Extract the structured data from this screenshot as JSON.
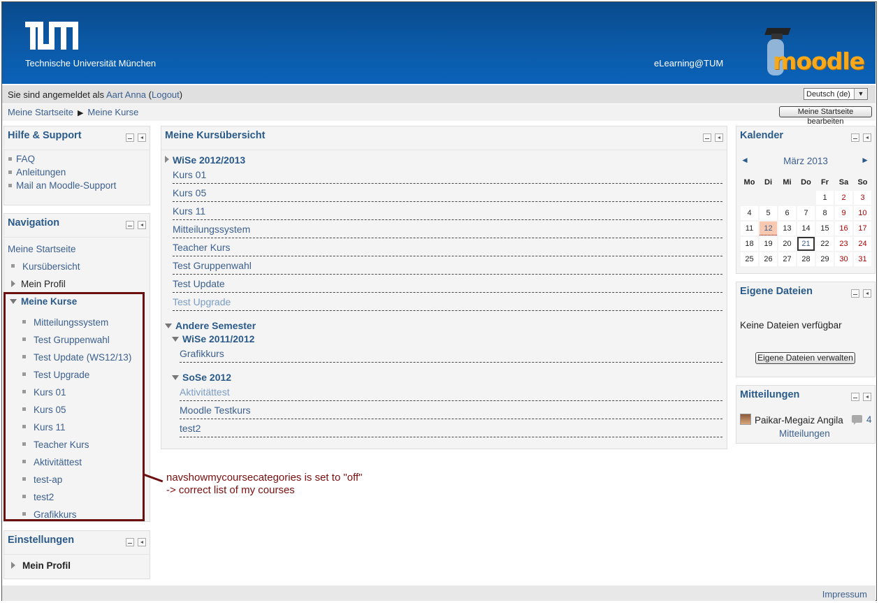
{
  "header": {
    "university": "Technische Universität München",
    "portal": "eLearning@TUM",
    "moodle_logo": "moodle"
  },
  "userbar": {
    "prefix": "Sie sind angemeldet als ",
    "username": "Aart Anna",
    "logout": "Logout",
    "language": "Deutsch (de)"
  },
  "breadcrumb": {
    "home": "Meine Startseite",
    "current": "Meine Kurse",
    "edit_button": "Meine Startseite bearbeiten"
  },
  "help_block": {
    "title": "Hilfe & Support",
    "items": [
      "FAQ",
      "Anleitungen",
      "Mail an Moodle-Support"
    ]
  },
  "navigation": {
    "title": "Navigation",
    "home": "Meine Startseite",
    "course_overview": "Kursübersicht",
    "my_profile": "Mein Profil",
    "my_courses": "Meine Kurse",
    "courses": [
      "Mitteilungssystem",
      "Test Gruppenwahl",
      "Test Update (WS12/13)",
      "Test Upgrade",
      "Kurs 01",
      "Kurs 05",
      "Kurs 11",
      "Teacher Kurs",
      "Aktivitättest",
      "test-ap",
      "test2",
      "Grafikkurs"
    ]
  },
  "settings": {
    "title": "Einstellungen",
    "profile": "Mein Profil"
  },
  "annotation": {
    "line1": "navshowmycoursecategories is set to \"off\"",
    "line2": "-> correct list of my courses",
    "color": "#6b0f0f"
  },
  "overview": {
    "title": "Meine Kursübersicht",
    "ws1213": "WiSe 2012/2013",
    "ws1213_courses": [
      "Kurs 01",
      "Kurs 05",
      "Kurs 11",
      "Mitteilungssystem",
      "Teacher Kurs",
      "Test Gruppenwahl",
      "Test Update",
      "Test Upgrade"
    ],
    "other": "Andere Semester",
    "ws1112": "WiSe 2011/2012",
    "ws1112_courses": [
      "Grafikkurs"
    ],
    "ss12": "SoSe 2012",
    "ss12_courses": [
      "Aktivitättest",
      "Moodle Testkurs",
      "test2"
    ]
  },
  "calendar": {
    "title": "Kalender",
    "month": "März 2013",
    "prev": "◄",
    "next": "►",
    "weekdays": [
      "Mo",
      "Di",
      "Mi",
      "Do",
      "Fr",
      "Sa",
      "So"
    ],
    "weeks": [
      [
        "",
        "",
        "",
        "",
        "1",
        "2",
        "3"
      ],
      [
        "4",
        "5",
        "6",
        "7",
        "8",
        "9",
        "10"
      ],
      [
        "11",
        "12",
        "13",
        "14",
        "15",
        "16",
        "17"
      ],
      [
        "18",
        "19",
        "20",
        "21",
        "22",
        "23",
        "24"
      ],
      [
        "25",
        "26",
        "27",
        "28",
        "29",
        "30",
        "31"
      ]
    ],
    "event_day": "12",
    "today": "21"
  },
  "files": {
    "title": "Eigene Dateien",
    "empty": "Keine Dateien verfügbar",
    "manage": "Eigene Dateien verwalten"
  },
  "messages": {
    "title": "Mitteilungen",
    "user": "Paikar-Megaiz Angila",
    "count": "4",
    "link": "Mitteilungen"
  },
  "footer": {
    "impressum": "Impressum"
  }
}
